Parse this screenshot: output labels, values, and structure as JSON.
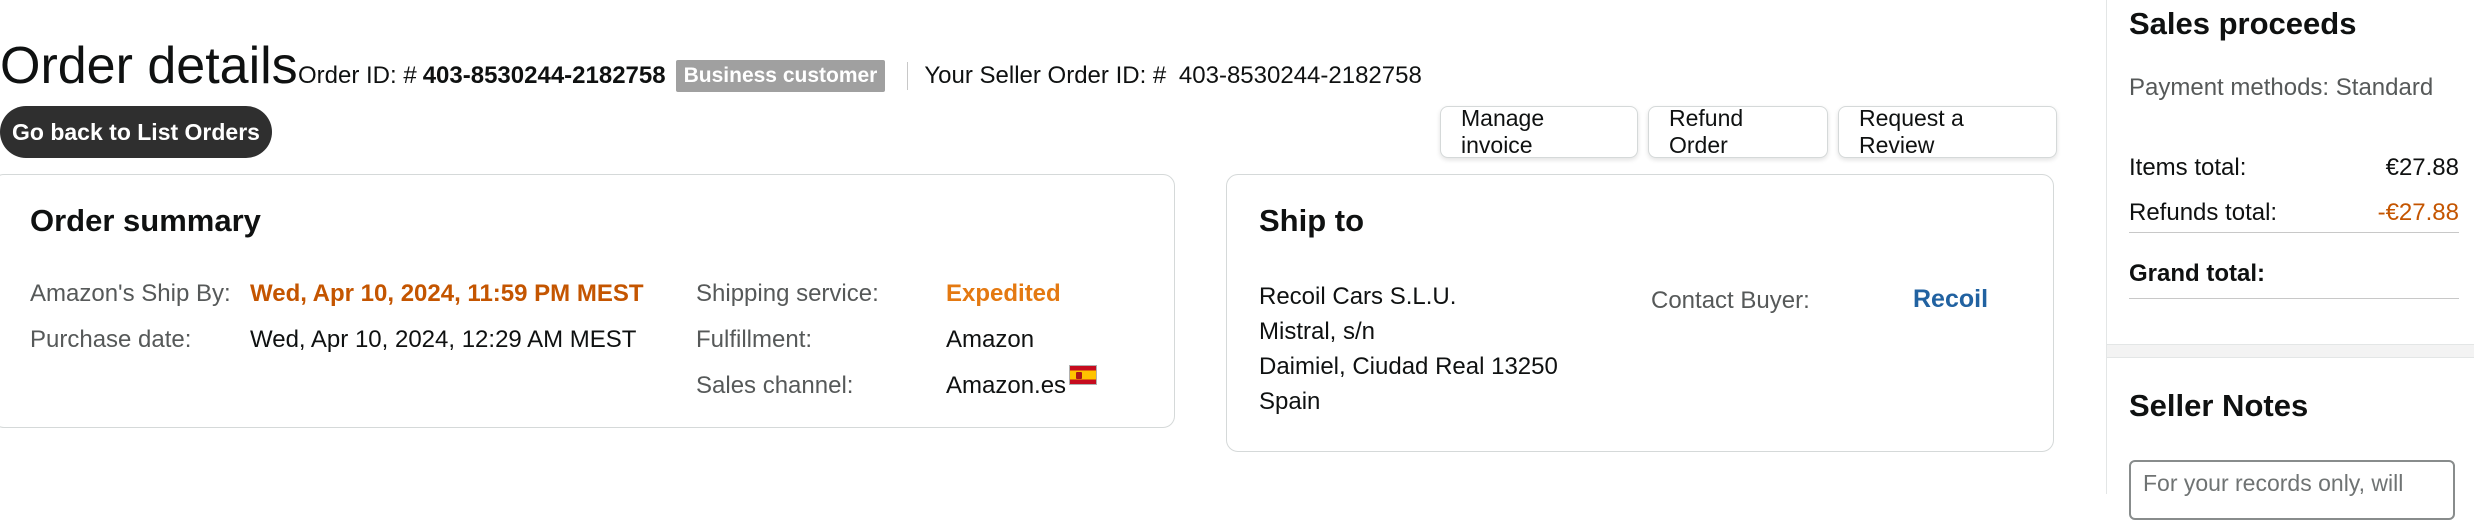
{
  "header": {
    "title": "Order details",
    "order_id_label": "Order ID: #",
    "order_id": "403-8530244-2182758",
    "badge": "Business customer",
    "seller_order_label": "Your Seller Order ID: #",
    "seller_order_id": "403-8530244-2182758"
  },
  "buttons": {
    "back": "Go back to List Orders",
    "manage_invoice": "Manage invoice",
    "refund_order": "Refund Order",
    "request_review": "Request a Review"
  },
  "order_summary": {
    "title": "Order summary",
    "ship_by_label": "Amazon's Ship By:",
    "ship_by_value": "Wed, Apr 10, 2024, 11:59 PM MEST",
    "purchase_date_label": "Purchase date:",
    "purchase_date_value": "Wed, Apr 10, 2024, 12:29 AM MEST",
    "shipping_service_label": "Shipping service:",
    "shipping_service_value": "Expedited",
    "fulfillment_label": "Fulfillment:",
    "fulfillment_value": "Amazon",
    "sales_channel_label": "Sales channel:",
    "sales_channel_value": "Amazon.es",
    "flag_icon": "spain-flag-icon"
  },
  "ship_to": {
    "title": "Ship to",
    "address_lines": [
      "Recoil Cars S.L.U.",
      "Mistral, s/n",
      "Daimiel, Ciudad Real 13250",
      "Spain"
    ],
    "contact_label": "Contact Buyer:",
    "contact_value": "Recoil"
  },
  "sidebar": {
    "sales_proceeds_title": "Sales proceeds",
    "payment_methods": "Payment methods: Standard",
    "items_total_label": "Items total:",
    "items_total_value": "€27.88",
    "refunds_total_label": "Refunds total:",
    "refunds_total_value": "-€27.88",
    "grand_total_label": "Grand total:",
    "grand_total_value": "",
    "seller_notes_title": "Seller Notes",
    "notes_placeholder": "For your records only, will"
  },
  "colors": {
    "accent_orange": "#c45500",
    "expedited_orange": "#e47911",
    "link_blue": "#2162a1",
    "dark_button": "#2f2f2f",
    "badge_gray": "#a0a0a0"
  }
}
